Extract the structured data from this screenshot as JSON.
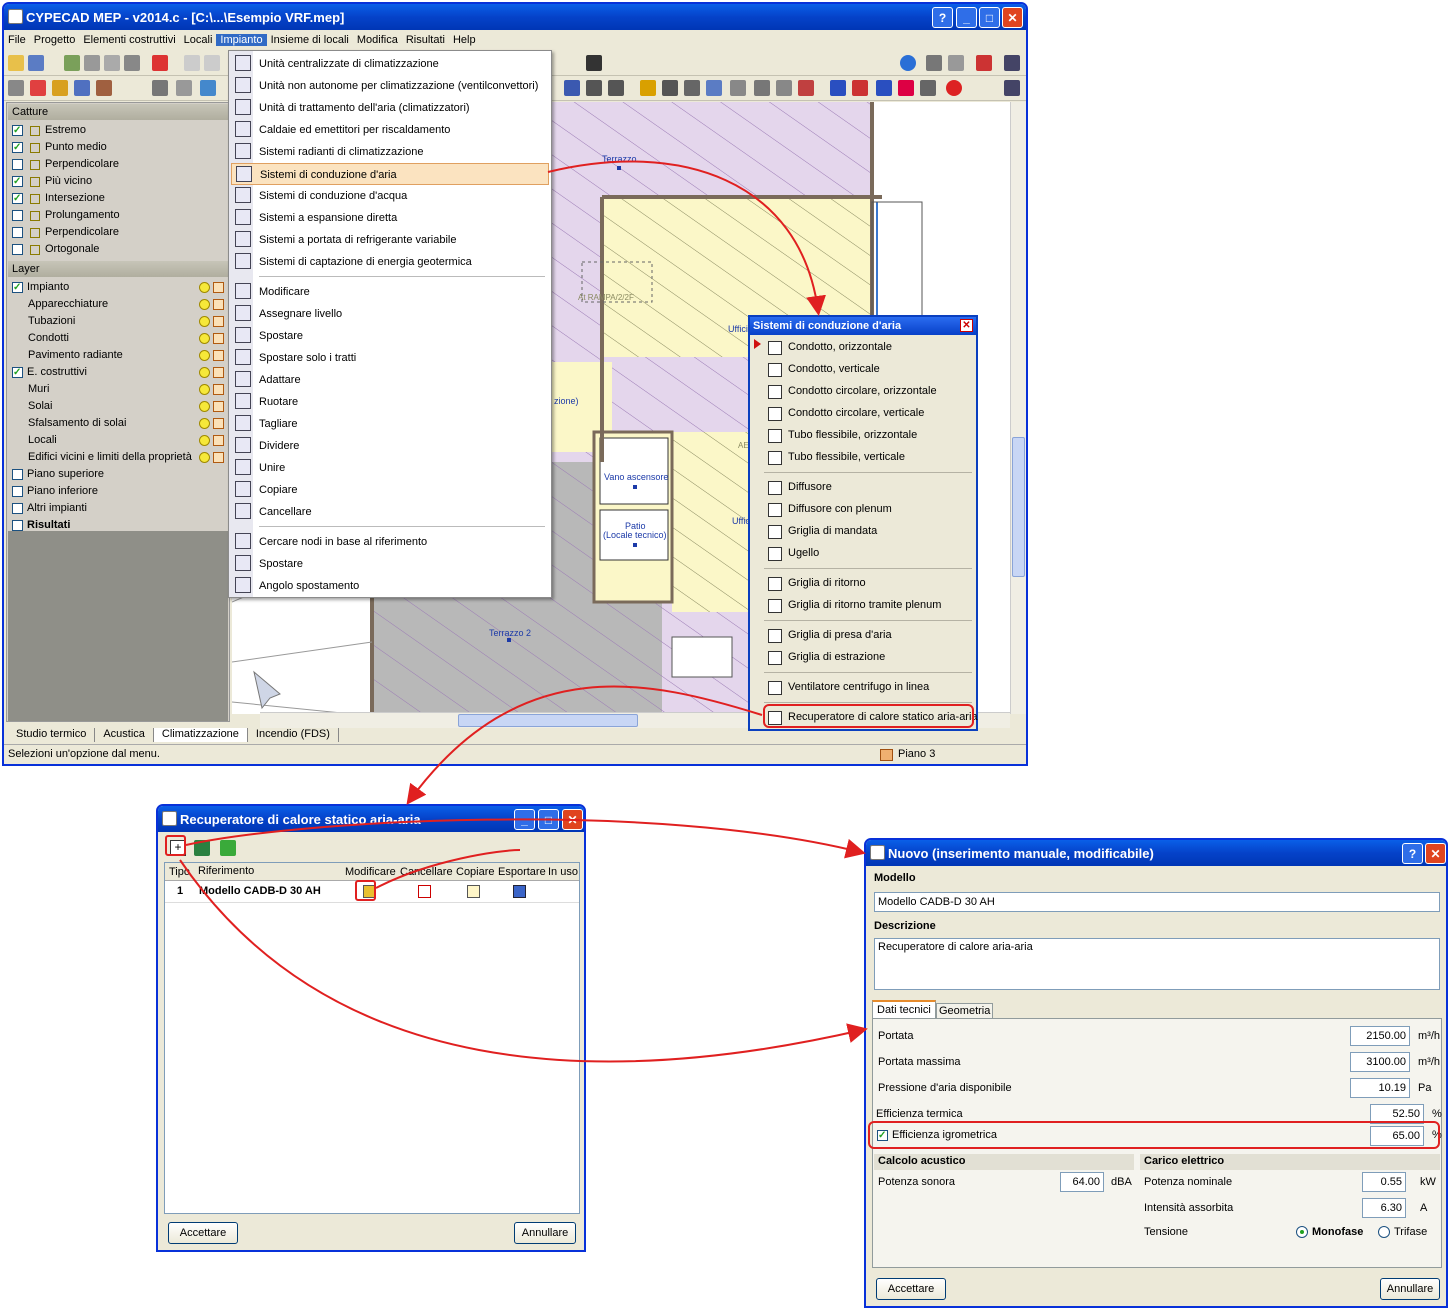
{
  "main_window": {
    "title": "CYPECAD MEP - v2014.c - [C:\\...\\Esempio VRF.mep]",
    "menu": [
      "File",
      "Progetto",
      "Elementi costruttivi",
      "Locali",
      "Impianto",
      "Insieme di locali",
      "Modifica",
      "Risultati",
      "Help"
    ],
    "active_menu": "Impianto",
    "status_text": "Selezioni un'opzione dal menu.",
    "floor_label": "Piano 3",
    "bottom_tabs": [
      "Studio termico",
      "Acustica",
      "Climatizzazione",
      "Incendio (FDS)"
    ],
    "active_tab": "Climatizzazione"
  },
  "catture": {
    "header": "Catture",
    "items": [
      {
        "label": "Estremo",
        "checked": true
      },
      {
        "label": "Punto medio",
        "checked": true
      },
      {
        "label": "Perpendicolare",
        "checked": false
      },
      {
        "label": "Più vicino",
        "checked": true
      },
      {
        "label": "Intersezione",
        "checked": true
      },
      {
        "label": "Prolungamento",
        "checked": false
      },
      {
        "label": "Perpendicolare",
        "checked": false
      },
      {
        "label": "Ortogonale",
        "checked": false
      }
    ]
  },
  "layer": {
    "header": "Layer",
    "items": [
      {
        "label": "Impianto",
        "checked": true,
        "indent": 0
      },
      {
        "label": "Apparecchiature",
        "indent": 1
      },
      {
        "label": "Tubazioni",
        "indent": 1
      },
      {
        "label": "Condotti",
        "indent": 1
      },
      {
        "label": "Pavimento radiante",
        "indent": 1
      },
      {
        "label": "E. costruttivi",
        "checked": true,
        "indent": 0
      },
      {
        "label": "Muri",
        "indent": 1
      },
      {
        "label": "Solai",
        "indent": 1
      },
      {
        "label": "Sfalsamento di solai",
        "indent": 1
      },
      {
        "label": "Locali",
        "indent": 1
      },
      {
        "label": "Edifici vicini e limiti della proprietà",
        "indent": 1
      },
      {
        "label": "Piano superiore",
        "checked": false,
        "indent": 0
      },
      {
        "label": "Piano inferiore",
        "checked": false,
        "indent": 0
      },
      {
        "label": "Altri impianti",
        "checked": false,
        "indent": 0
      },
      {
        "label": "Risultati",
        "checked": false,
        "indent": 0,
        "bold": true
      }
    ]
  },
  "impianto_menu": {
    "group1": [
      "Unità centralizzate di climatizzazione",
      "Unità non autonome per climatizzazione (ventilconvettori)",
      "Unità di trattamento dell'aria (climatizzatori)",
      "Caldaie ed emettitori per riscaldamento",
      "Sistemi radianti di climatizzazione",
      "Sistemi di conduzione d'aria",
      "Sistemi di conduzione d'acqua",
      "Sistemi a espansione diretta",
      "Sistemi a portata di refrigerante variabile",
      "Sistemi di captazione di energia geotermica"
    ],
    "highlighted": "Sistemi di conduzione d'aria",
    "group2": [
      "Modificare",
      "Assegnare livello",
      "Spostare",
      "Spostare solo i tratti",
      "Adattare",
      "Ruotare",
      "Tagliare",
      "Dividere",
      "Unire",
      "Copiare",
      "Cancellare"
    ],
    "group3": [
      "Cercare nodi in base al riferimento",
      "Spostare",
      "Angolo spostamento"
    ]
  },
  "floorplan_labels": {
    "terrazzo": "Terrazzo",
    "terrazzo2": "Terrazzo 2",
    "ufficio": "Uffici",
    "ufficio2": "Uffic",
    "vano": "Vano ascensore",
    "patio1": "Patio",
    "patio2": "(Locale tecnico)",
    "zione": "zione)",
    "at": "At  RAMPA/2/2F",
    "ae": "AE",
    "frag": "Ufficio"
  },
  "aria_popup": {
    "title": "Sistemi di conduzione d'aria",
    "items": [
      {
        "label": "Condotto, orizzontale",
        "group": 1
      },
      {
        "label": "Condotto, verticale",
        "group": 1
      },
      {
        "label": "Condotto circolare, orizzontale",
        "group": 1
      },
      {
        "label": "Condotto circolare, verticale",
        "group": 1
      },
      {
        "label": "Tubo flessibile, orizzontale",
        "group": 1
      },
      {
        "label": "Tubo flessibile, verticale",
        "group": 1
      },
      {
        "label": "Diffusore",
        "group": 2
      },
      {
        "label": "Diffusore con plenum",
        "group": 2
      },
      {
        "label": "Griglia di mandata",
        "group": 2
      },
      {
        "label": "Ugello",
        "group": 2
      },
      {
        "label": "Griglia di ritorno",
        "group": 3
      },
      {
        "label": "Griglia di ritorno tramite plenum",
        "group": 3
      },
      {
        "label": "Griglia di presa d'aria",
        "group": 4
      },
      {
        "label": "Griglia di estrazione",
        "group": 4
      },
      {
        "label": "Ventilatore centrifugo in linea",
        "group": 5
      },
      {
        "label": "Recuperatore di calore statico aria-aria",
        "group": 6
      }
    ]
  },
  "recuperatore_dialog": {
    "title": "Recuperatore di calore statico aria-aria",
    "columns": [
      "Tipo",
      "Riferimento",
      "Modificare",
      "Cancellare",
      "Copiare",
      "Esportare",
      "In uso"
    ],
    "rows": [
      {
        "tipo": "1",
        "riferimento": "Modello CADB-D 30 AH"
      }
    ],
    "accept": "Accettare",
    "cancel": "Annullare"
  },
  "nuovo_dialog": {
    "title": "Nuovo (inserimento manuale, modificabile)",
    "modello_label": "Modello",
    "modello_value": "Modello CADB-D 30 AH",
    "descrizione_label": "Descrizione",
    "descrizione_value": "Recuperatore di calore aria-aria",
    "tabs": [
      "Dati tecnici",
      "Geometria"
    ],
    "active_tab": "Dati tecnici",
    "params": [
      {
        "label": "Portata",
        "value": "2150.00",
        "unit": "m³/h"
      },
      {
        "label": "Portata massima",
        "value": "3100.00",
        "unit": "m³/h"
      },
      {
        "label": "Pressione d'aria disponibile",
        "value": "10.19",
        "unit": "Pa"
      },
      {
        "label": "Efficienza termica",
        "value": "52.50",
        "unit": "%"
      }
    ],
    "igrometrica": {
      "label": "Efficienza igrometrica",
      "value": "65.00",
      "unit": "%",
      "checked": true
    },
    "acustico": {
      "header": "Calcolo acustico",
      "label": "Potenza sonora",
      "value": "64.00",
      "unit": "dBA"
    },
    "elettrico": {
      "header": "Carico elettrico",
      "potenza": {
        "label": "Potenza nominale",
        "value": "0.55",
        "unit": "kW"
      },
      "intensita": {
        "label": "Intensità assorbita",
        "value": "6.30",
        "unit": "A"
      },
      "tensione_label": "Tensione",
      "options": [
        "Monofase",
        "Trifase"
      ],
      "selected": "Monofase"
    },
    "accept": "Accettare",
    "cancel": "Annullare"
  },
  "colors": {
    "accent_red": "#e02020",
    "title_blue": "#0542c9",
    "menu_highlight": "#fbe3c0"
  }
}
